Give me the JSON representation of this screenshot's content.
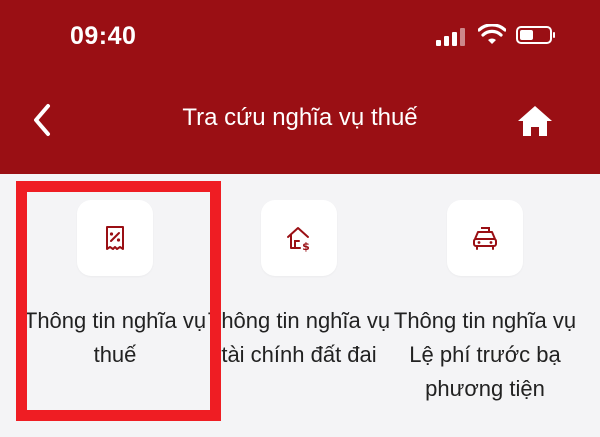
{
  "status_bar": {
    "time": "09:40"
  },
  "header": {
    "title": "Tra cứu nghĩa vụ thuế"
  },
  "items": [
    {
      "label": "Thông tin nghĩa vụ thuế"
    },
    {
      "label": "Thông tin nghĩa vụ tài chính đất đai"
    },
    {
      "label": "Thông tin nghĩa vụ Lệ phí trước bạ phương tiện"
    }
  ],
  "colors": {
    "header_bg": "#9a0f14",
    "accent": "#9a0f14",
    "highlight": "#ef1d23",
    "page_bg": "#f4f4f6"
  }
}
